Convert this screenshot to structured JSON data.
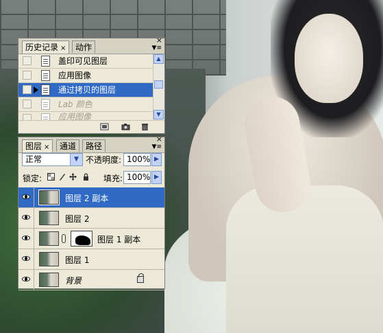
{
  "history_panel": {
    "tabs": [
      {
        "label": "历史记录",
        "active": true,
        "close_icon": "×"
      },
      {
        "label": "动作",
        "active": false
      }
    ],
    "panel_close_icon": "×",
    "menu_icon": "▼≡",
    "items": [
      {
        "label": "盖印可见图层",
        "state": "normal"
      },
      {
        "label": "应用图像",
        "state": "normal"
      },
      {
        "label": "通过拷贝的图层",
        "state": "selected"
      },
      {
        "label": "Lab 颜色",
        "state": "undone"
      },
      {
        "label": "应用图像",
        "state": "undone"
      }
    ],
    "bottom_icons": [
      "new-document-from-state-icon",
      "camera-snapshot-icon",
      "trash-icon"
    ]
  },
  "layers_panel": {
    "tabs": [
      {
        "label": "图层",
        "active": true,
        "close_icon": "×"
      },
      {
        "label": "通道",
        "active": false
      },
      {
        "label": "路径",
        "active": false
      }
    ],
    "panel_close_icon": "×",
    "menu_icon": "▼≡",
    "blend_mode": "正常",
    "opacity_label": "不透明度:",
    "opacity_value": "100%",
    "lock_label": "锁定:",
    "lock_icons": [
      "lock-transparent-icon",
      "lock-paint-icon",
      "lock-move-icon",
      "lock-all-icon"
    ],
    "fill_label": "填充:",
    "fill_value": "100%",
    "layers": [
      {
        "name": "图层 2 副本",
        "selected": true,
        "has_mask": false,
        "italic": false,
        "locked": false
      },
      {
        "name": "图层 2",
        "selected": false,
        "has_mask": false,
        "italic": false,
        "locked": false
      },
      {
        "name": "图层 1 副本",
        "selected": false,
        "has_mask": true,
        "italic": false,
        "locked": false
      },
      {
        "name": "图层 1",
        "selected": false,
        "has_mask": false,
        "italic": false,
        "locked": false
      },
      {
        "name": "背景",
        "selected": false,
        "has_mask": false,
        "italic": true,
        "locked": true
      }
    ]
  },
  "colors": {
    "selection": "#316ac5",
    "panel_bg": "#ece9d8",
    "tab_bg": "#d6d3c3"
  }
}
